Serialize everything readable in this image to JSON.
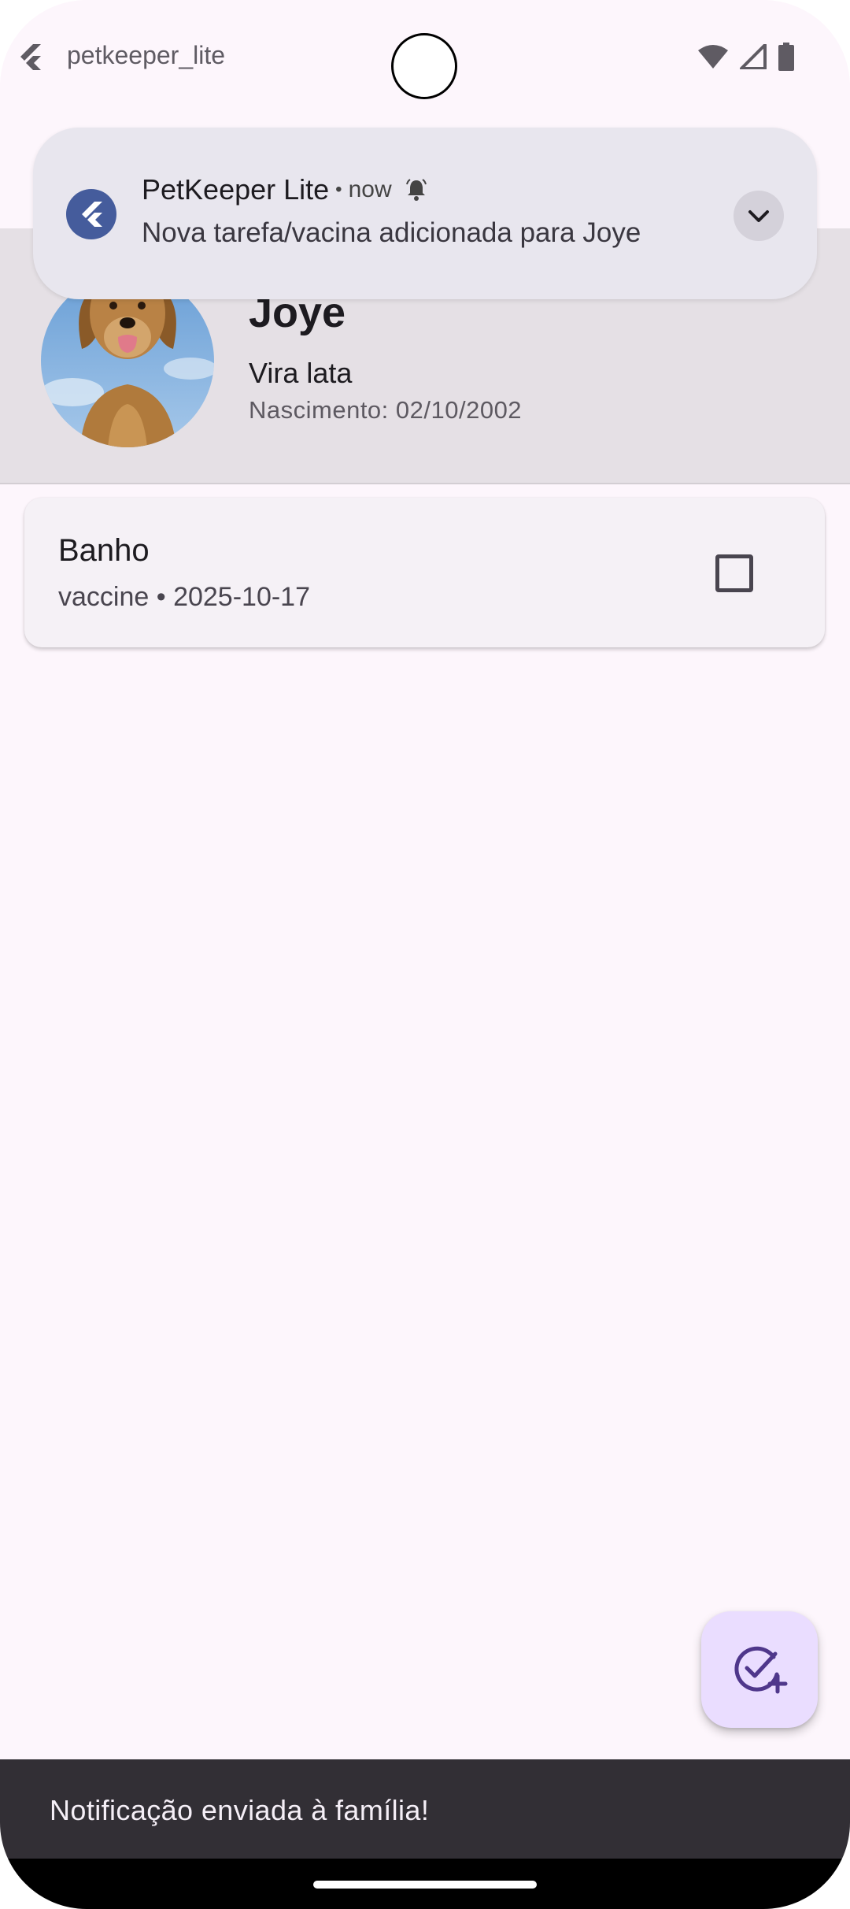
{
  "status_bar": {
    "app_name": "petkeeper_lite",
    "app_icon": "flutter-logo-icon",
    "icons": [
      "wifi-icon",
      "signal-icon",
      "battery-icon"
    ]
  },
  "notification": {
    "app_name": "PetKeeper Lite",
    "time": "now",
    "separator": "•",
    "message": "Nova tarefa/vacina adicionada para Joye",
    "icon": "flutter-logo-icon",
    "alert_icon": "bell-icon",
    "expand_icon": "chevron-down-icon"
  },
  "pet": {
    "name": "Joye",
    "breed": "Vira lata",
    "birth": "Nascimento: 02/10/2002",
    "avatar_icon": "dog-photo"
  },
  "tasks": [
    {
      "title": "Banho",
      "subtitle": "vaccine • 2025-10-17",
      "done": false
    }
  ],
  "fab": {
    "icon": "add-task-icon"
  },
  "snackbar": {
    "text": "Notificação enviada à família!"
  },
  "colors": {
    "background": "#fdf6fc",
    "header": "#e5e0e5",
    "card": "#f5f1f6",
    "fab": "#eaddff",
    "accent": "#65558f",
    "snackbar": "#322f35"
  }
}
